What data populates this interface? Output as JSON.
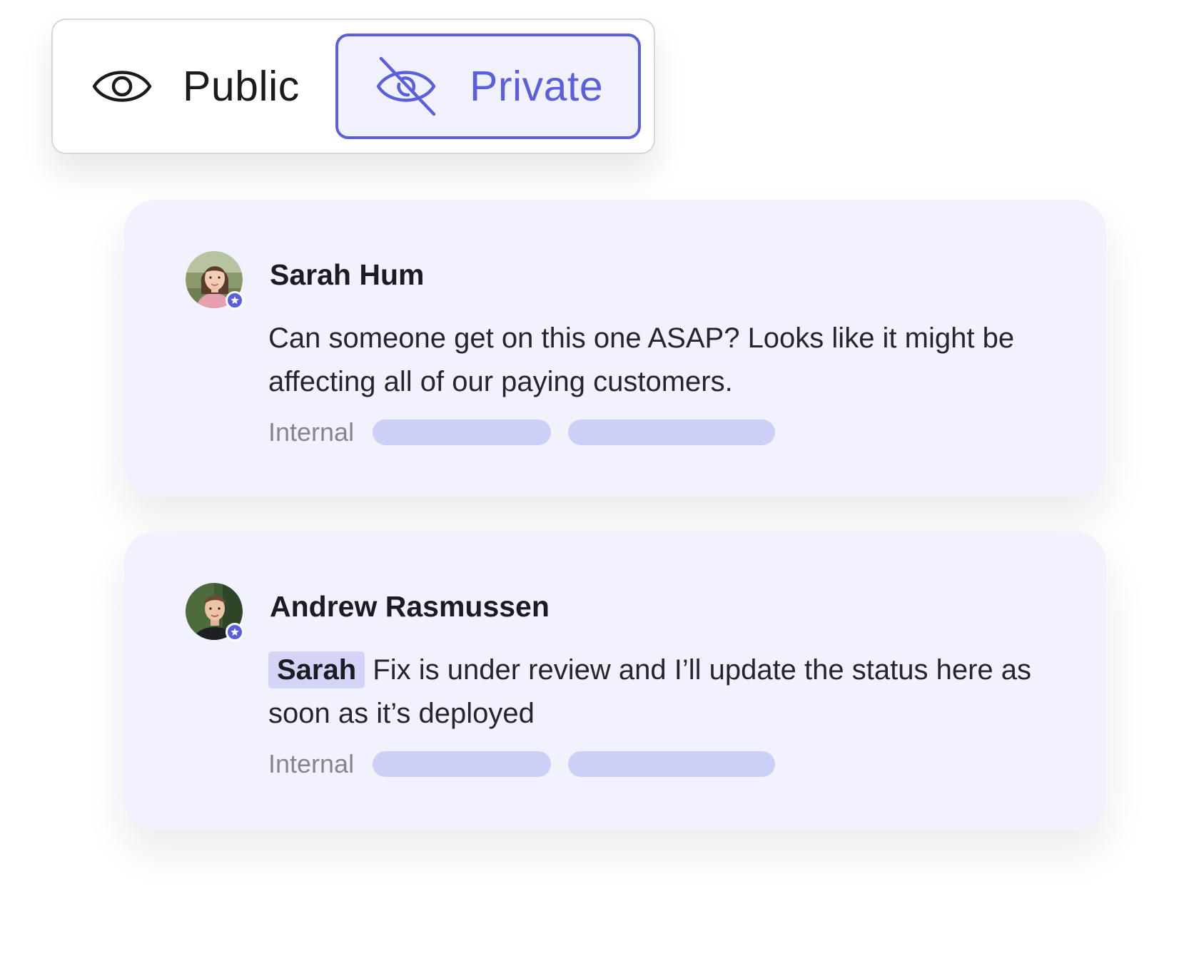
{
  "visibility_toggle": {
    "options": [
      {
        "label": "Public",
        "icon": "eye-icon",
        "selected": false
      },
      {
        "label": "Private",
        "icon": "eye-off-icon",
        "selected": true
      }
    ],
    "accent_color": "#5b5fdb"
  },
  "comments": [
    {
      "author": "Sarah Hum",
      "avatar": "avatar-sarah",
      "badge_icon": "star-icon",
      "mention": "",
      "text": "Can someone get on this one ASAP? Looks like it might be affecting all of our paying customers.",
      "visibility_label": "Internal"
    },
    {
      "author": "Andrew Rasmussen",
      "avatar": "avatar-andrew",
      "badge_icon": "star-icon",
      "mention": "Sarah",
      "text": "Fix is under review and I’ll update the status here as soon as it’s deployed",
      "visibility_label": "Internal"
    }
  ],
  "colors": {
    "card_background": "#f1f2fd",
    "placeholder_pill": "#cdd0f6",
    "mention_highlight": "#d2d5f6"
  }
}
